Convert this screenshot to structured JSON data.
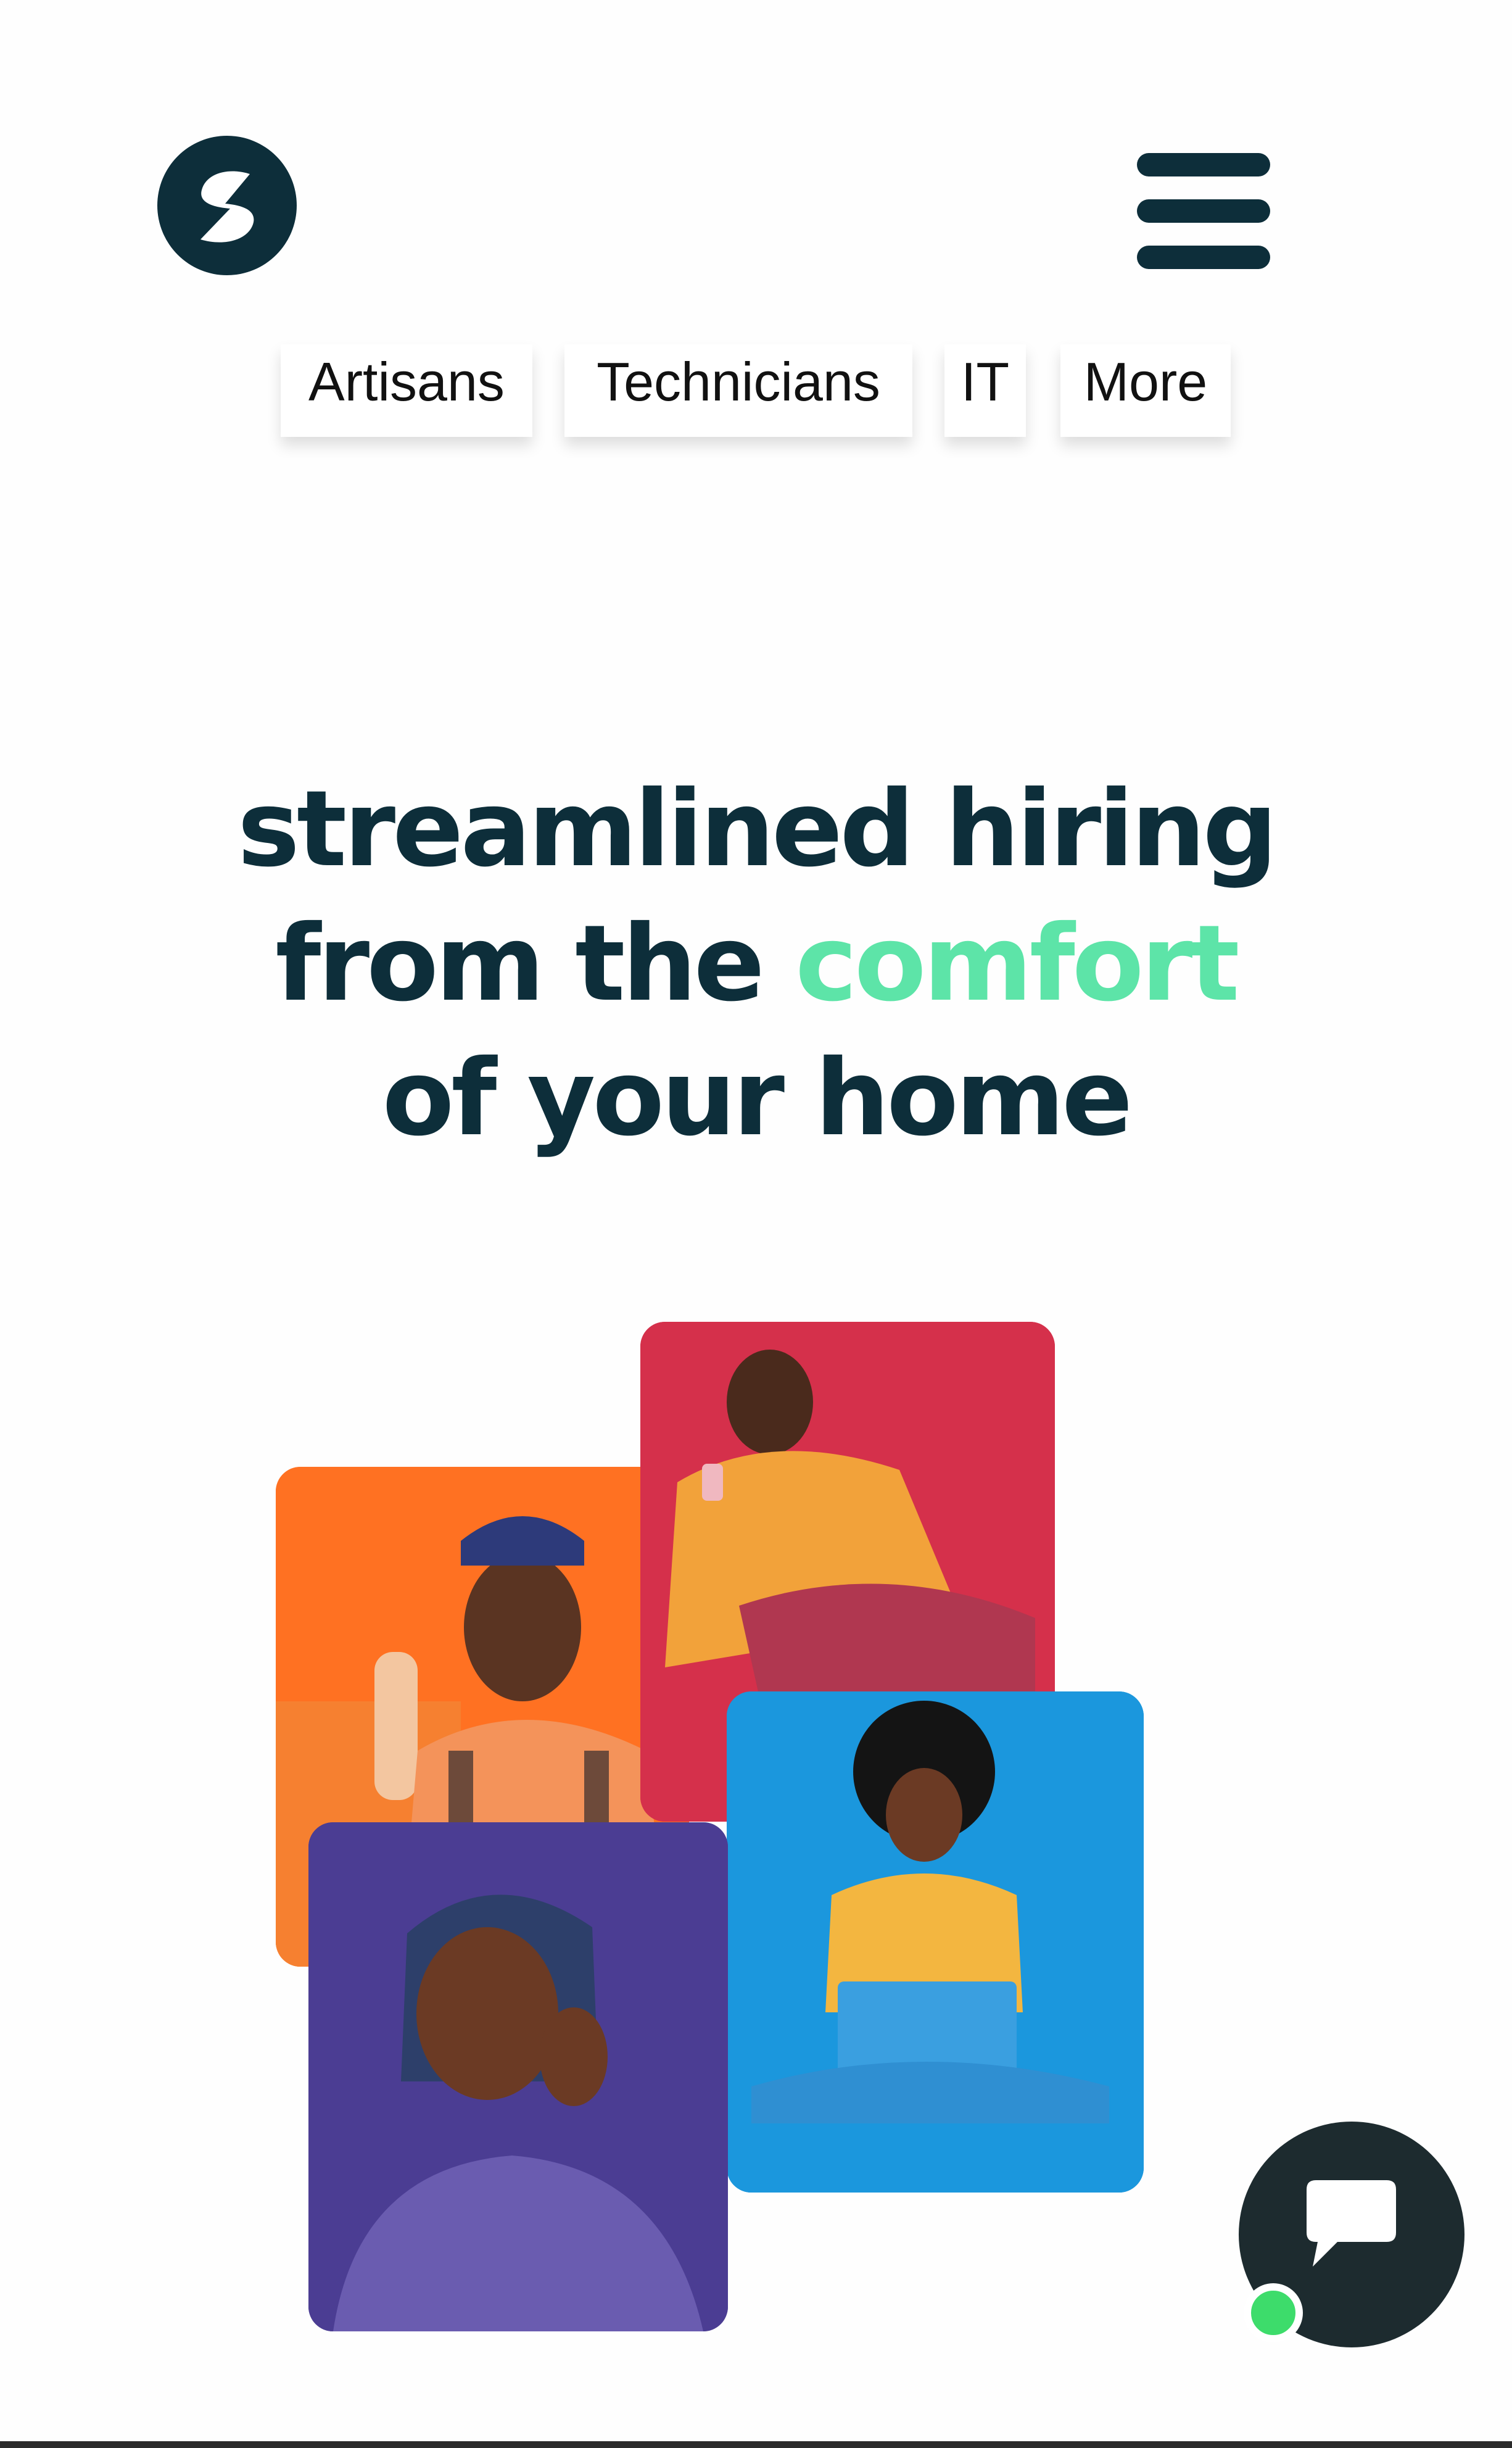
{
  "header": {
    "logo_icon": "brand-s-logo-icon",
    "menu_icon": "hamburger-menu-icon"
  },
  "nav": {
    "tabs": [
      {
        "label": "Artisans"
      },
      {
        "label": "Technicians"
      },
      {
        "label": "IT"
      },
      {
        "label": "More"
      }
    ]
  },
  "hero": {
    "headline_line1": "streamlined hiring",
    "headline_line2_part1": "from the",
    "headline_line2_accent": "comfort",
    "headline_line3": "of your home",
    "accent_color": "#5de4a8",
    "text_color": "#0d2e3a"
  },
  "images": [
    {
      "name": "artisan-cleaner-photo",
      "bg_color": "#ff7122"
    },
    {
      "name": "man-with-phone-photo",
      "bg_color": "#d5304b"
    },
    {
      "name": "woman-with-laptop-photo",
      "bg_color": "#1b97dd"
    },
    {
      "name": "woman-in-hijab-photo",
      "bg_color": "#4b3d93"
    }
  ],
  "chat_widget": {
    "icon": "chat-bubble-icon",
    "status_color": "#3ddc6b"
  }
}
